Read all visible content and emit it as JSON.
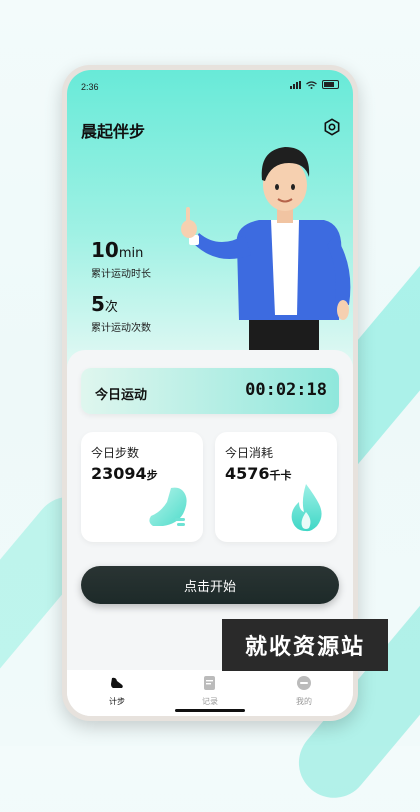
{
  "status_bar": {
    "time": "2:36"
  },
  "app": {
    "title": "晨起伴步"
  },
  "stats": [
    {
      "value": "10",
      "unit": "min",
      "label": "累计运动时长"
    },
    {
      "value": "5",
      "unit": "次",
      "label": "累计运动次数"
    }
  ],
  "today_exercise": {
    "label": "今日运动",
    "value": "00:02:18"
  },
  "steps": {
    "title": "今日步数",
    "value": "23094",
    "unit": "步"
  },
  "calories": {
    "title": "今日消耗",
    "value": "4576",
    "unit": "千卡"
  },
  "start_button": {
    "label": "点击开始"
  },
  "watermark": "就收资源站",
  "tabs": [
    {
      "label": "计步",
      "icon": "shoe-icon",
      "active": true
    },
    {
      "label": "记录",
      "icon": "note-icon",
      "active": false
    },
    {
      "label": "我的",
      "icon": "profile-icon",
      "active": false
    }
  ],
  "colors": {
    "accent": "#7de9da",
    "button": "#1f2b2a",
    "flame": "#6ee2d4"
  }
}
